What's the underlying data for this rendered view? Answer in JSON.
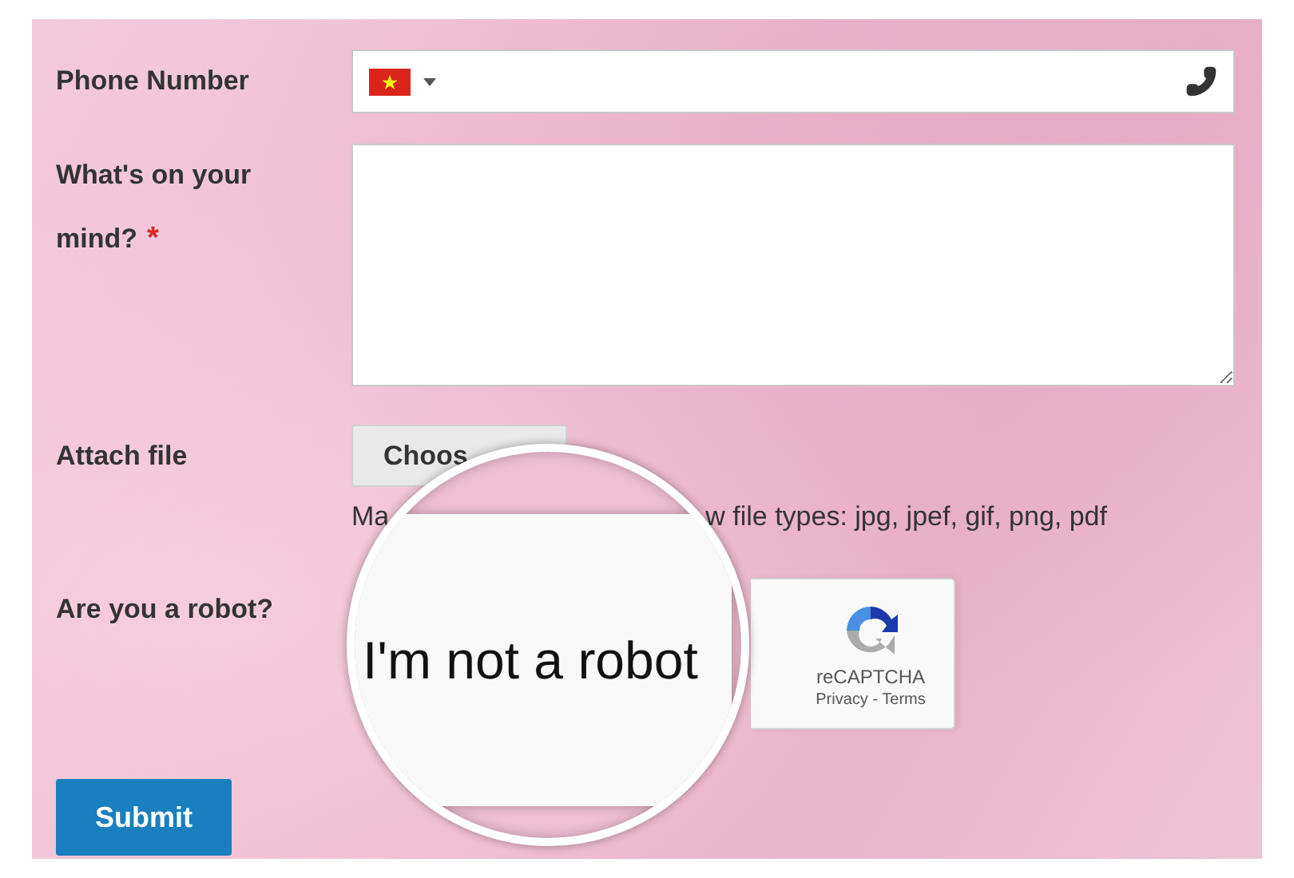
{
  "form": {
    "fields": [
      {
        "kind": "phone",
        "label": "Phone Number"
      },
      {
        "kind": "textarea",
        "label": "What's on your mind?",
        "required_mark": "*"
      },
      {
        "kind": "file",
        "label": "Attach file",
        "button": "Choos",
        "hint_start": "Ma",
        "hint_end": "w file types: jpg, jpef, gif, png, pdf"
      },
      {
        "kind": "captcha",
        "label": "Are you a robot?",
        "brand": "reCAPTCHA",
        "links": "Privacy - Terms"
      }
    ],
    "submit": "Submit"
  },
  "magnifier": {
    "text": "I'm not a robot"
  }
}
